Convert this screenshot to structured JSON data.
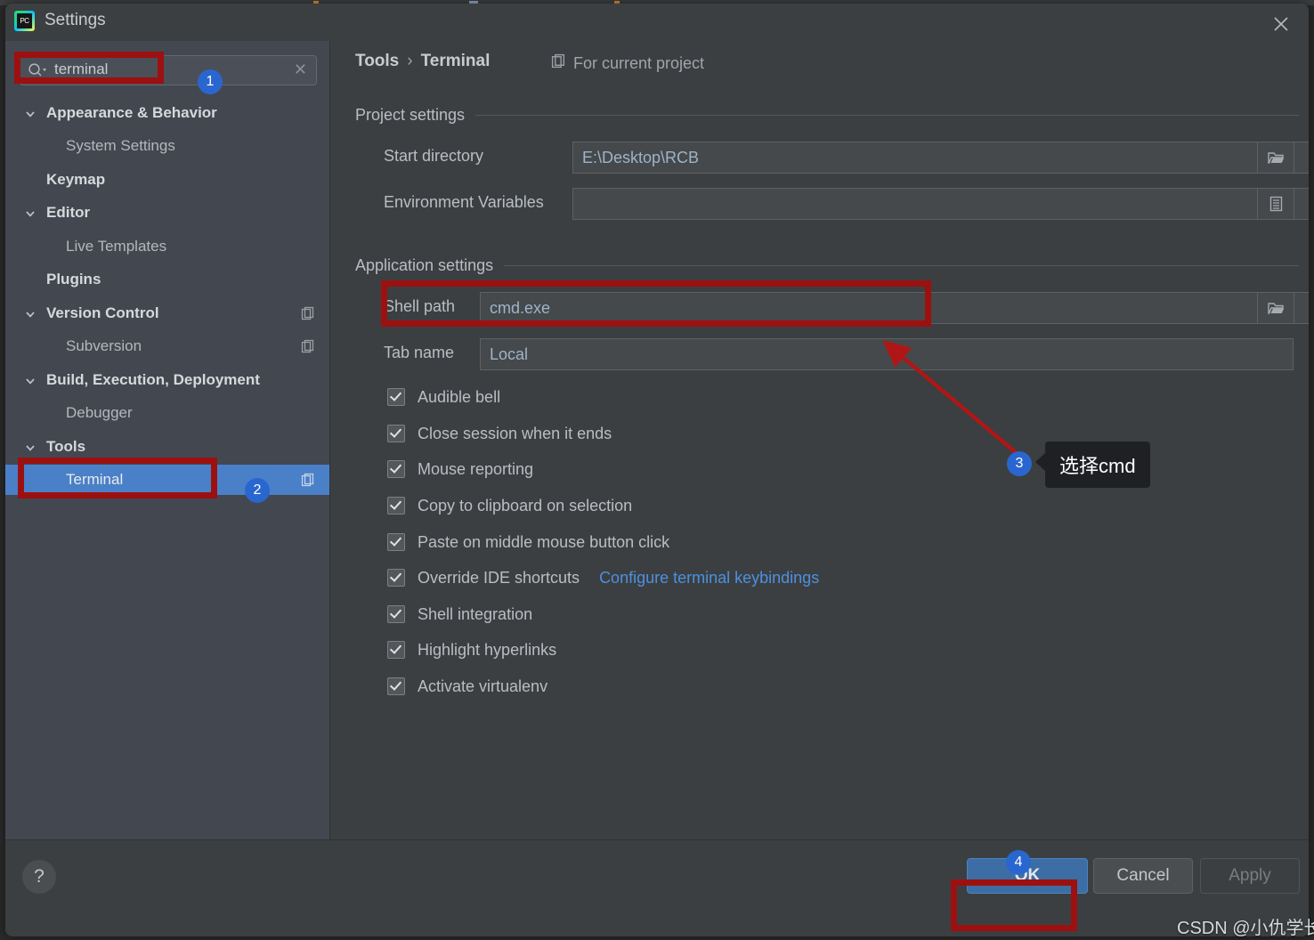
{
  "window": {
    "title": "Settings",
    "app_icon": "pycharm-icon",
    "close_icon": "close-icon"
  },
  "sidebar": {
    "search": {
      "value": "terminal",
      "placeholder": "",
      "icon": "search-icon",
      "clear_icon": "close-icon"
    },
    "items": [
      {
        "label": "Appearance & Behavior",
        "level": "group",
        "expanded": true,
        "selected": false,
        "copy_icon": false
      },
      {
        "label": "System Settings",
        "level": "leaf",
        "expanded": false,
        "selected": false,
        "copy_icon": false
      },
      {
        "label": "Keymap",
        "level": "group",
        "expanded": false,
        "selected": false,
        "copy_icon": false
      },
      {
        "label": "Editor",
        "level": "group",
        "expanded": true,
        "selected": false,
        "copy_icon": false
      },
      {
        "label": "Live Templates",
        "level": "leaf",
        "expanded": false,
        "selected": false,
        "copy_icon": false
      },
      {
        "label": "Plugins",
        "level": "group",
        "expanded": false,
        "selected": false,
        "copy_icon": false
      },
      {
        "label": "Version Control",
        "level": "group",
        "expanded": true,
        "selected": false,
        "copy_icon": true
      },
      {
        "label": "Subversion",
        "level": "leaf",
        "expanded": false,
        "selected": false,
        "copy_icon": true
      },
      {
        "label": "Build, Execution, Deployment",
        "level": "group",
        "expanded": true,
        "selected": false,
        "copy_icon": false
      },
      {
        "label": "Debugger",
        "level": "leaf",
        "expanded": false,
        "selected": false,
        "copy_icon": false
      },
      {
        "label": "Tools",
        "level": "group",
        "expanded": true,
        "selected": false,
        "copy_icon": false
      },
      {
        "label": "Terminal",
        "level": "leaf",
        "expanded": false,
        "selected": true,
        "copy_icon": true
      }
    ]
  },
  "content": {
    "breadcrumb": {
      "parent": "Tools",
      "separator": "›",
      "current": "Terminal"
    },
    "for_current_project": {
      "label": "For current project",
      "icon": "copy-icon"
    },
    "project_settings": {
      "title": "Project settings",
      "start_directory": {
        "label": "Start directory",
        "value": "E:\\Desktop\\RCB",
        "browse_icon": "folder-icon"
      },
      "environment_variables": {
        "label": "Environment Variables",
        "value": "",
        "browse_icon": "list-icon"
      }
    },
    "application_settings": {
      "title": "Application settings",
      "shell_path": {
        "label": "Shell path",
        "value": "cmd.exe",
        "browse_icon": "folder-icon"
      },
      "tab_name": {
        "label": "Tab name",
        "value": "Local"
      },
      "checkboxes": [
        {
          "label": "Audible bell",
          "checked": true
        },
        {
          "label": "Close session when it ends",
          "checked": true
        },
        {
          "label": "Mouse reporting",
          "checked": true
        },
        {
          "label": "Copy to clipboard on selection",
          "checked": true
        },
        {
          "label": "Paste on middle mouse button click",
          "checked": true
        },
        {
          "label": "Override IDE shortcuts",
          "checked": true,
          "link": "Configure terminal keybindings"
        },
        {
          "label": "Shell integration",
          "checked": true
        },
        {
          "label": "Highlight hyperlinks",
          "checked": true
        },
        {
          "label": "Activate virtualenv",
          "checked": true
        }
      ]
    }
  },
  "footer": {
    "help_label": "?",
    "ok_label": "OK",
    "cancel_label": "Cancel",
    "apply_label": "Apply"
  },
  "annotations": {
    "badge1": "1",
    "badge2": "2",
    "badge3": "3",
    "badge4": "4",
    "callout3": "选择cmd",
    "watermark": "CSDN @小仇学长",
    "highlight_color": "#9d1010",
    "badge_color": "#2a66d0"
  }
}
